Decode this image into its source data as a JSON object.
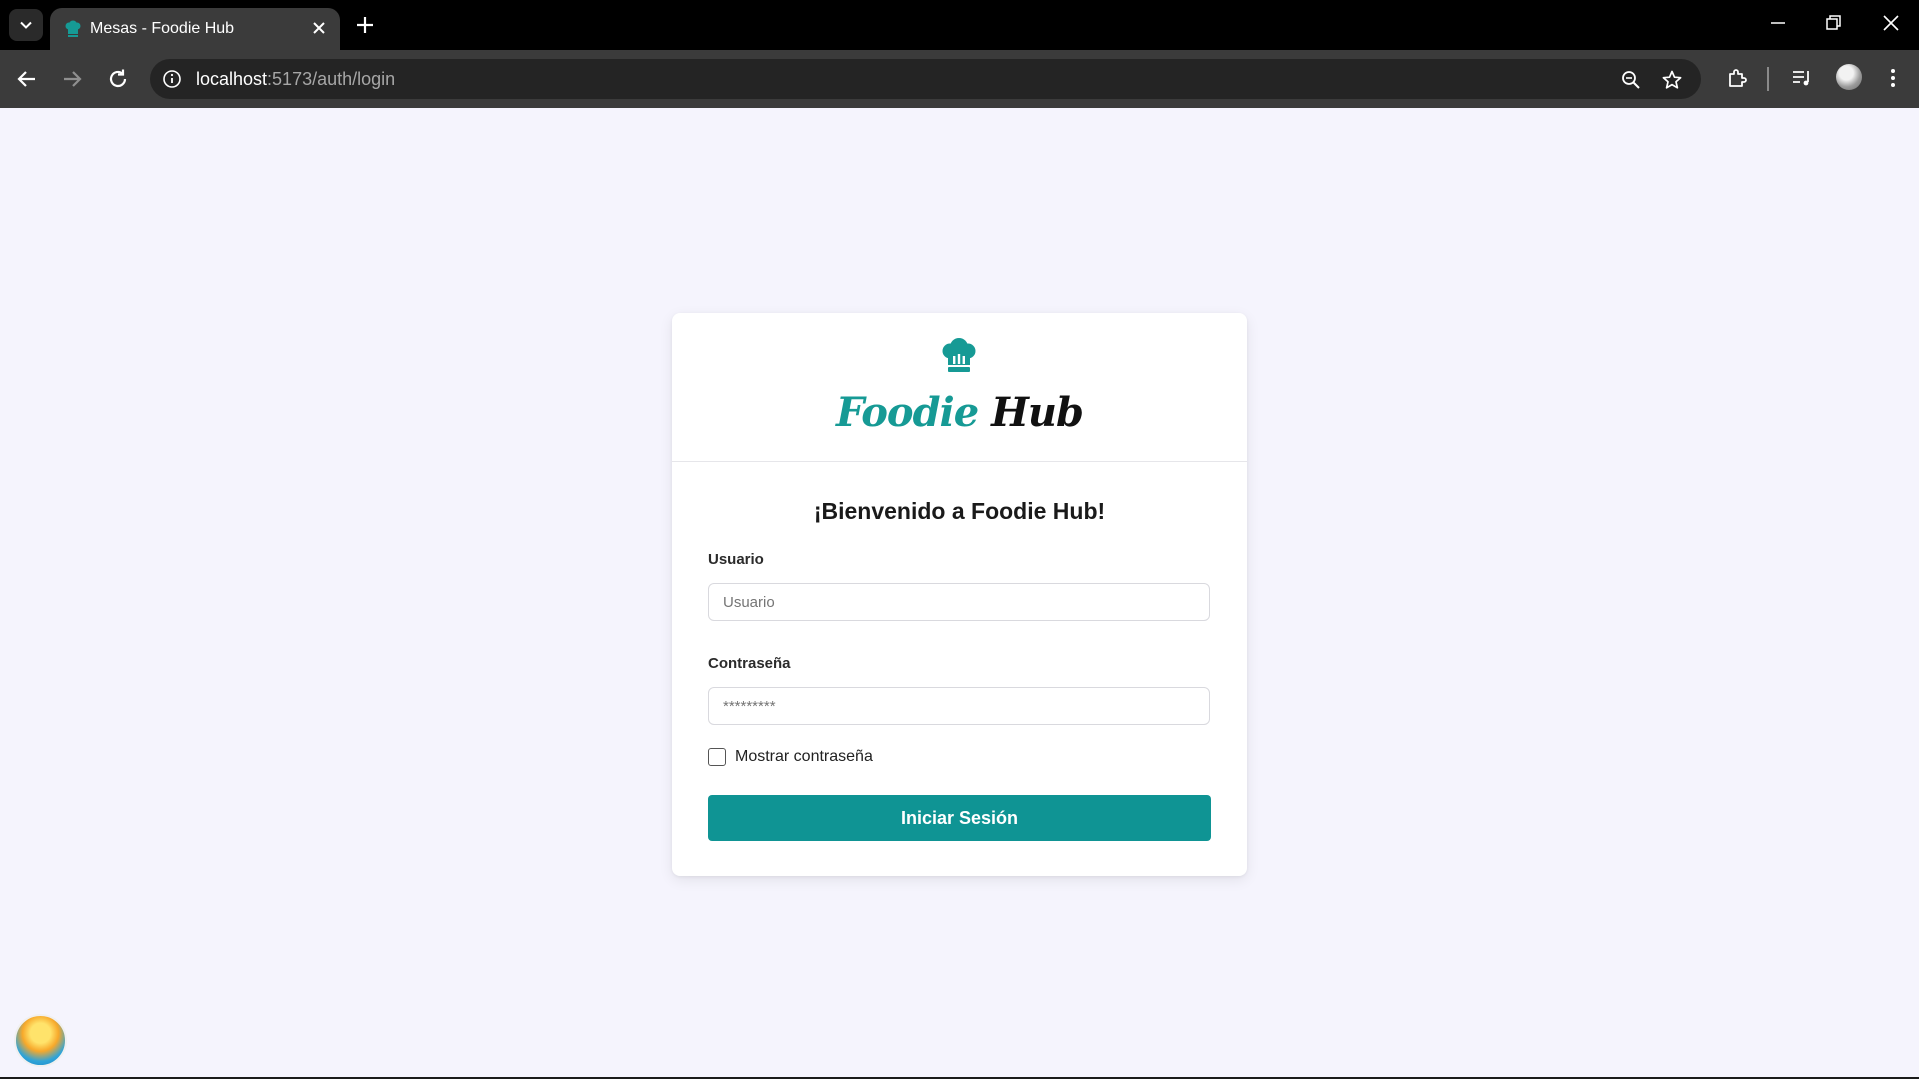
{
  "browser": {
    "tab_title": "Mesas - Foodie Hub",
    "url_host": "localhost",
    "url_path": ":5173/auth/login"
  },
  "brand": {
    "part1": "Foodie",
    "part2": "Hub"
  },
  "login": {
    "heading": "¡Bienvenido a Foodie Hub!",
    "user_label": "Usuario",
    "user_placeholder": "Usuario",
    "password_label": "Contraseña",
    "password_placeholder": "*********",
    "show_password_label": "Mostrar contraseña",
    "submit_label": "Iniciar Sesión"
  },
  "colors": {
    "accent": "#0f9494",
    "brand_teal": "#169a95",
    "page_background": "#f5f4fd"
  },
  "icons": {
    "tab_favicon": "chef-hat-icon",
    "logo": "chef-hat-icon",
    "taskbar": "island-sunset-icon"
  }
}
